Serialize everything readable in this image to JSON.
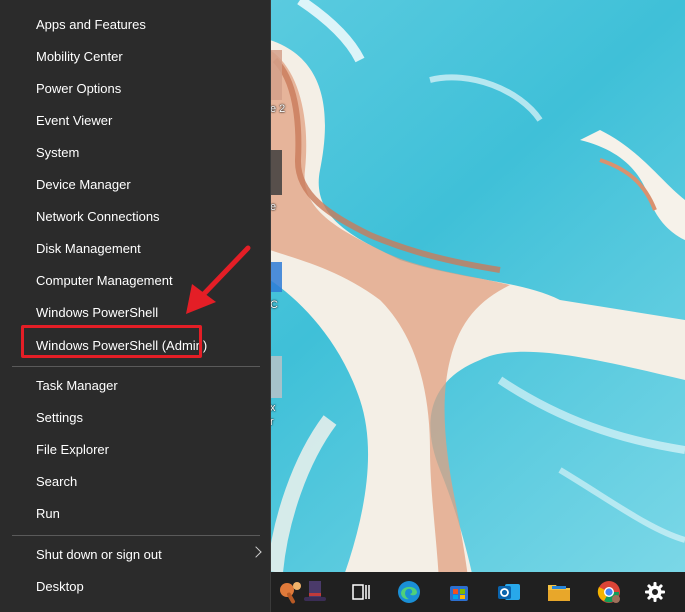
{
  "menu": {
    "section1": [
      {
        "id": "apps-and-features",
        "label": "Apps and Features"
      },
      {
        "id": "mobility-center",
        "label": "Mobility Center"
      },
      {
        "id": "power-options",
        "label": "Power Options"
      },
      {
        "id": "event-viewer",
        "label": "Event Viewer"
      },
      {
        "id": "system",
        "label": "System"
      },
      {
        "id": "device-manager",
        "label": "Device Manager"
      },
      {
        "id": "network-connections",
        "label": "Network Connections"
      },
      {
        "id": "disk-management",
        "label": "Disk Management"
      },
      {
        "id": "computer-management",
        "label": "Computer Management"
      },
      {
        "id": "windows-powershell",
        "label": "Windows PowerShell"
      },
      {
        "id": "windows-powershell-admin",
        "label": "Windows PowerShell (Admin)"
      }
    ],
    "section2": [
      {
        "id": "task-manager",
        "label": "Task Manager"
      },
      {
        "id": "settings",
        "label": "Settings"
      },
      {
        "id": "file-explorer",
        "label": "File Explorer"
      },
      {
        "id": "search",
        "label": "Search"
      },
      {
        "id": "run",
        "label": "Run"
      }
    ],
    "section3": [
      {
        "id": "shut-down-or-sign-out",
        "label": "Shut down or sign out"
      },
      {
        "id": "desktop",
        "label": "Desktop"
      }
    ]
  },
  "desktop_fragments": [
    "e 2",
    "e",
    "C",
    "x",
    "r"
  ],
  "colors": {
    "menu_bg": "#2b2b2b",
    "highlight": "#e41e26",
    "taskbar_bg": "#202020"
  },
  "taskbar": {
    "icons": [
      "tools-icon",
      "tophat-icon",
      "task-view-icon",
      "edge-icon",
      "store-icon",
      "outlook-icon",
      "file-explorer-icon",
      "chrome-icon",
      "settings-gear-icon"
    ]
  }
}
